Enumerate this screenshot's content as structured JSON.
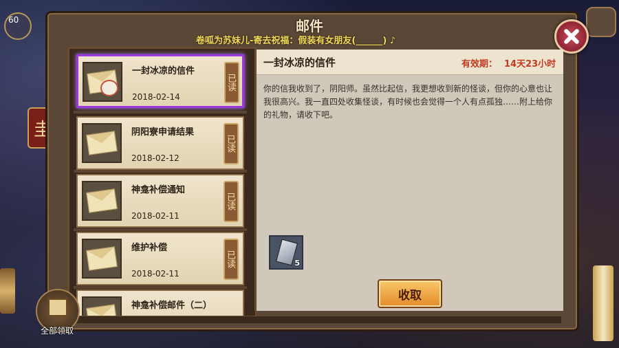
{
  "player": {
    "level": "60"
  },
  "dialog": {
    "title": "邮件",
    "marquee": "卷呱为苏妹儿-寄去祝福：假装有女朋友(______)  ♪"
  },
  "mail_list": [
    {
      "subject": "一封冰凉的信件",
      "date": "2018-02-14",
      "status": "已读",
      "selected": true
    },
    {
      "subject": "阴阳寮申请结果",
      "date": "2018-02-12",
      "status": "已读"
    },
    {
      "subject": "神龛补偿通知",
      "date": "2018-02-11",
      "status": "已读"
    },
    {
      "subject": "维护补偿",
      "date": "2018-02-11",
      "status": "已读"
    },
    {
      "subject": "神龛补偿邮件（二）",
      "date": "",
      "status": ""
    }
  ],
  "detail": {
    "subject": "一封冰凉的信件",
    "validity_label": "有效期：",
    "validity_value": "14天23小时",
    "body": "你的信我收到了，阴阳师。虽然比起信，我更想收到新的怪谈，但你的心意也让我很高兴。我一直四处收集怪谈，有时候也会觉得一个人有点孤独……附上给你的礼物，请收下吧。",
    "attachment_count": "5",
    "claim_label": "收取"
  },
  "footer": {
    "claim_all_label": "全部领取"
  }
}
